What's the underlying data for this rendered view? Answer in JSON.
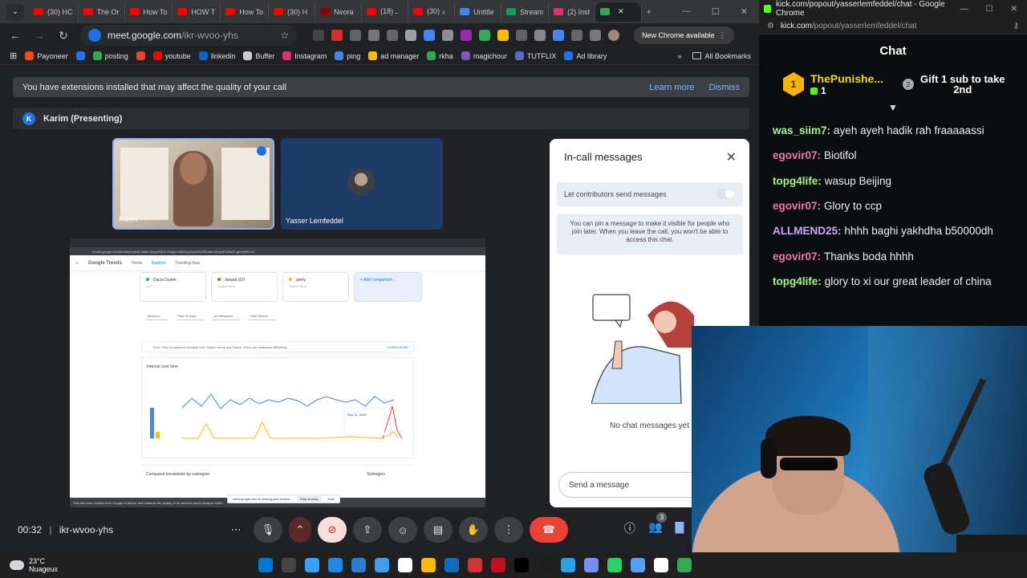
{
  "browser": {
    "tabs": [
      {
        "label": "(30) HC",
        "color": "#ff0000"
      },
      {
        "label": "The Or",
        "color": "#ff0000"
      },
      {
        "label": "How To",
        "color": "#ff0000"
      },
      {
        "label": "HOW T",
        "color": "#ff0000"
      },
      {
        "label": "How To",
        "color": "#ff0000"
      },
      {
        "label": "(30) H",
        "color": "#ff0000"
      },
      {
        "label": "Neora",
        "color": "#8b0000"
      },
      {
        "label": "(18) ـ",
        "color": "#ff0000"
      },
      {
        "label": "(30) د",
        "color": "#ff0000"
      },
      {
        "label": "Untitle",
        "color": "#4285f4"
      },
      {
        "label": "Stream",
        "color": "#0f9d58"
      },
      {
        "label": "(2) Inst",
        "color": "#e1306c"
      },
      {
        "label": "",
        "color": "#34a853"
      }
    ],
    "new_tab": "+",
    "address": {
      "host": "meet.google.com",
      "path": "/ikr-wvoo-yhs"
    },
    "new_chrome_label": "New Chrome available",
    "bookmarks": [
      {
        "label": "Payoneer",
        "color": "#ff4800"
      },
      {
        "label": "",
        "color": "#1877f2"
      },
      {
        "label": "posting",
        "color": "#34a853"
      },
      {
        "label": "",
        "color": "#ea4335"
      },
      {
        "label": "youtube",
        "color": "#ff0000"
      },
      {
        "label": "linkedin",
        "color": "#0a66c2"
      },
      {
        "label": "Buffer",
        "color": "#cccccc"
      },
      {
        "label": "Instagram",
        "color": "#e1306c"
      },
      {
        "label": "ping",
        "color": "#4285f4"
      },
      {
        "label": "ad manager",
        "color": "#fbbc04"
      },
      {
        "label": "rkha",
        "color": "#34a853"
      },
      {
        "label": "magichour",
        "color": "#7e57c2"
      },
      {
        "label": "TUTFLIX",
        "color": "#5c6bc0"
      },
      {
        "label": "Ad library",
        "color": "#1877f2"
      }
    ],
    "all_bookmarks": "All Bookmarks"
  },
  "meet": {
    "banner": {
      "text": "You have extensions installed that may affect the quality of your call",
      "learn_more": "Learn more",
      "dismiss": "Dismiss"
    },
    "presenting": {
      "initial": "K",
      "label": "Karim (Presenting)"
    },
    "tiles": [
      {
        "name": "Karim"
      },
      {
        "name": "Yasser Lemfeddel"
      }
    ],
    "shared_screen": {
      "address": "trends.google.com/trends/explore?date=today%201-m&geo=MA&q=Dacia%20Duster,deepal%20s07,geely&hl=en",
      "logo": "Google Trends",
      "nav": [
        "Home",
        "Explore",
        "Trending Now"
      ],
      "terms": [
        {
          "name": "Dacia Duster",
          "sub": "SUV",
          "color": "#4285f4"
        },
        {
          "name": "deepal sO7",
          "sub": "Search term",
          "color": "#ea4335"
        },
        {
          "name": "geely",
          "sub": "Search term",
          "color": "#fbbc04"
        }
      ],
      "add_comparison": "+ Add comparison",
      "filters": [
        "Morocco",
        "Past 30 days",
        "All categories",
        "Web Search"
      ],
      "note": "Note: This comparison contains both Search terms and Topics, which are measured differently.",
      "learn_more": "LEARN MORE",
      "interest_title": "Interest over time",
      "tooltip_date": "Sep 11, 2025",
      "breakdown_title": "Compared breakdown by subregion",
      "breakdown_dropdown": "Subregion",
      "sharing_notice": "meet.google.com is sharing your screen.",
      "stop_sharing": "Stop sharing",
      "hide": "Hide",
      "footer": "This site uses cookies from Google to deliver and enhance the quality of its services and to analyze traffic."
    },
    "panel": {
      "title": "In-call messages",
      "permission": "Let contributors send messages",
      "pin_note": "You can pin a message to make it visible for people who join later. When you leave the call, you won't be able to access this chat.",
      "empty": "No chat messages yet",
      "placeholder": "Send a message"
    },
    "clock": "00:32",
    "meeting_code": "ikr-wvoo-yhs",
    "participants_count": "3"
  },
  "kick": {
    "window_title": "kick.com/popout/yasserlemfeddel/chat - Google Chrome",
    "address": {
      "host": "kick.com",
      "path": "/popout/yasserlemfeddel/chat"
    },
    "heading": "Chat",
    "top_gifter": {
      "rank": "1",
      "name": "ThePunishe...",
      "count": "1"
    },
    "gift_cta": {
      "rank": "2",
      "line1": "Gift 1 sub to take",
      "line2": "2nd"
    },
    "messages": [
      {
        "user": "was_siim7:",
        "text": "ayeh ayeh hadik rah fraaaaassi",
        "color": "#a3f58a"
      },
      {
        "user": "egovir07:",
        "text": "Biotifol",
        "color": "#f07aa7"
      },
      {
        "user": "topg4life:",
        "text": "wasup Beijing",
        "color": "#a3f58a"
      },
      {
        "user": "egovir07:",
        "text": "Glory to ccp",
        "color": "#f07aa7"
      },
      {
        "user": "ALLMEND25:",
        "text": "hhhh baghi yakhdha b50000dh",
        "color": "#c9a7ff"
      },
      {
        "user": "egovir07:",
        "text": "Thanks boda hhhh",
        "color": "#f07aa7"
      },
      {
        "user": "topg4life:",
        "text": "glory to xi our great leader of china",
        "color": "#a3f58a"
      }
    ]
  },
  "taskbar": {
    "weather_temp": "23°C",
    "weather_text": "Nuageux",
    "apps": [
      "#0078d4",
      "#444444",
      "#3aa0ff",
      "#1e88e5",
      "#2b7cd3",
      "#3c9ef0",
      "#ffffff",
      "#ffb900",
      "#0f6cbd",
      "#d13438",
      "#c50f1f",
      "#000000",
      "#1f1f1f",
      "#2aa3e6",
      "#7b8cff",
      "#25d366",
      "#54a0ff",
      "#ffffff",
      "#34a853"
    ]
  }
}
